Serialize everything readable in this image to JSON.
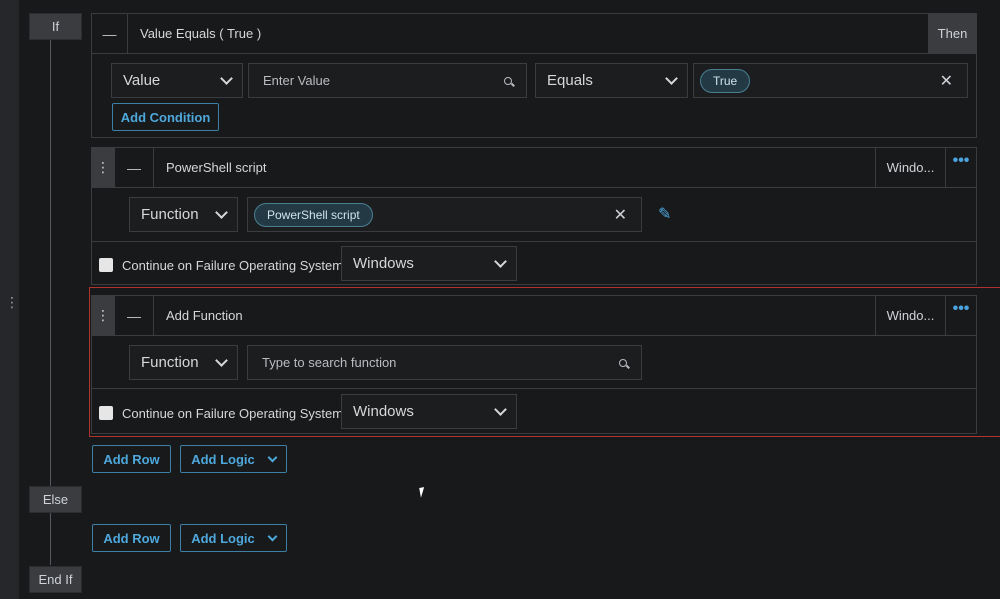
{
  "rail": {
    "handle_icon": "kebab-vertical-icon"
  },
  "branches": {
    "if_label": "If",
    "else_label": "Else",
    "endif_label": "End If"
  },
  "condition": {
    "title": "Value Equals ( True )",
    "then_label": "Then",
    "field_select": "Value",
    "value_placeholder": "Enter Value",
    "operator_select": "Equals",
    "value_chip": "True",
    "add_condition_label": "Add Condition"
  },
  "steps": [
    {
      "title": "PowerShell script",
      "os_short": "Windo...",
      "type_select": "Function",
      "function_chip": "PowerShell script",
      "continue_label": "Continue on Failure",
      "os_label": "Operating System:",
      "os_select": "Windows"
    },
    {
      "title": "Add Function",
      "os_short": "Windo...",
      "type_select": "Function",
      "search_placeholder": "Type to search function",
      "continue_label": "Continue on Failure",
      "os_label": "Operating System:",
      "os_select": "Windows"
    }
  ],
  "actions": {
    "add_row": "Add Row",
    "add_logic": "Add Logic"
  },
  "colors": {
    "accent": "#4fa8dc",
    "background": "#18191b",
    "panel": "#3a3c40",
    "highlight": "#b0332e"
  }
}
